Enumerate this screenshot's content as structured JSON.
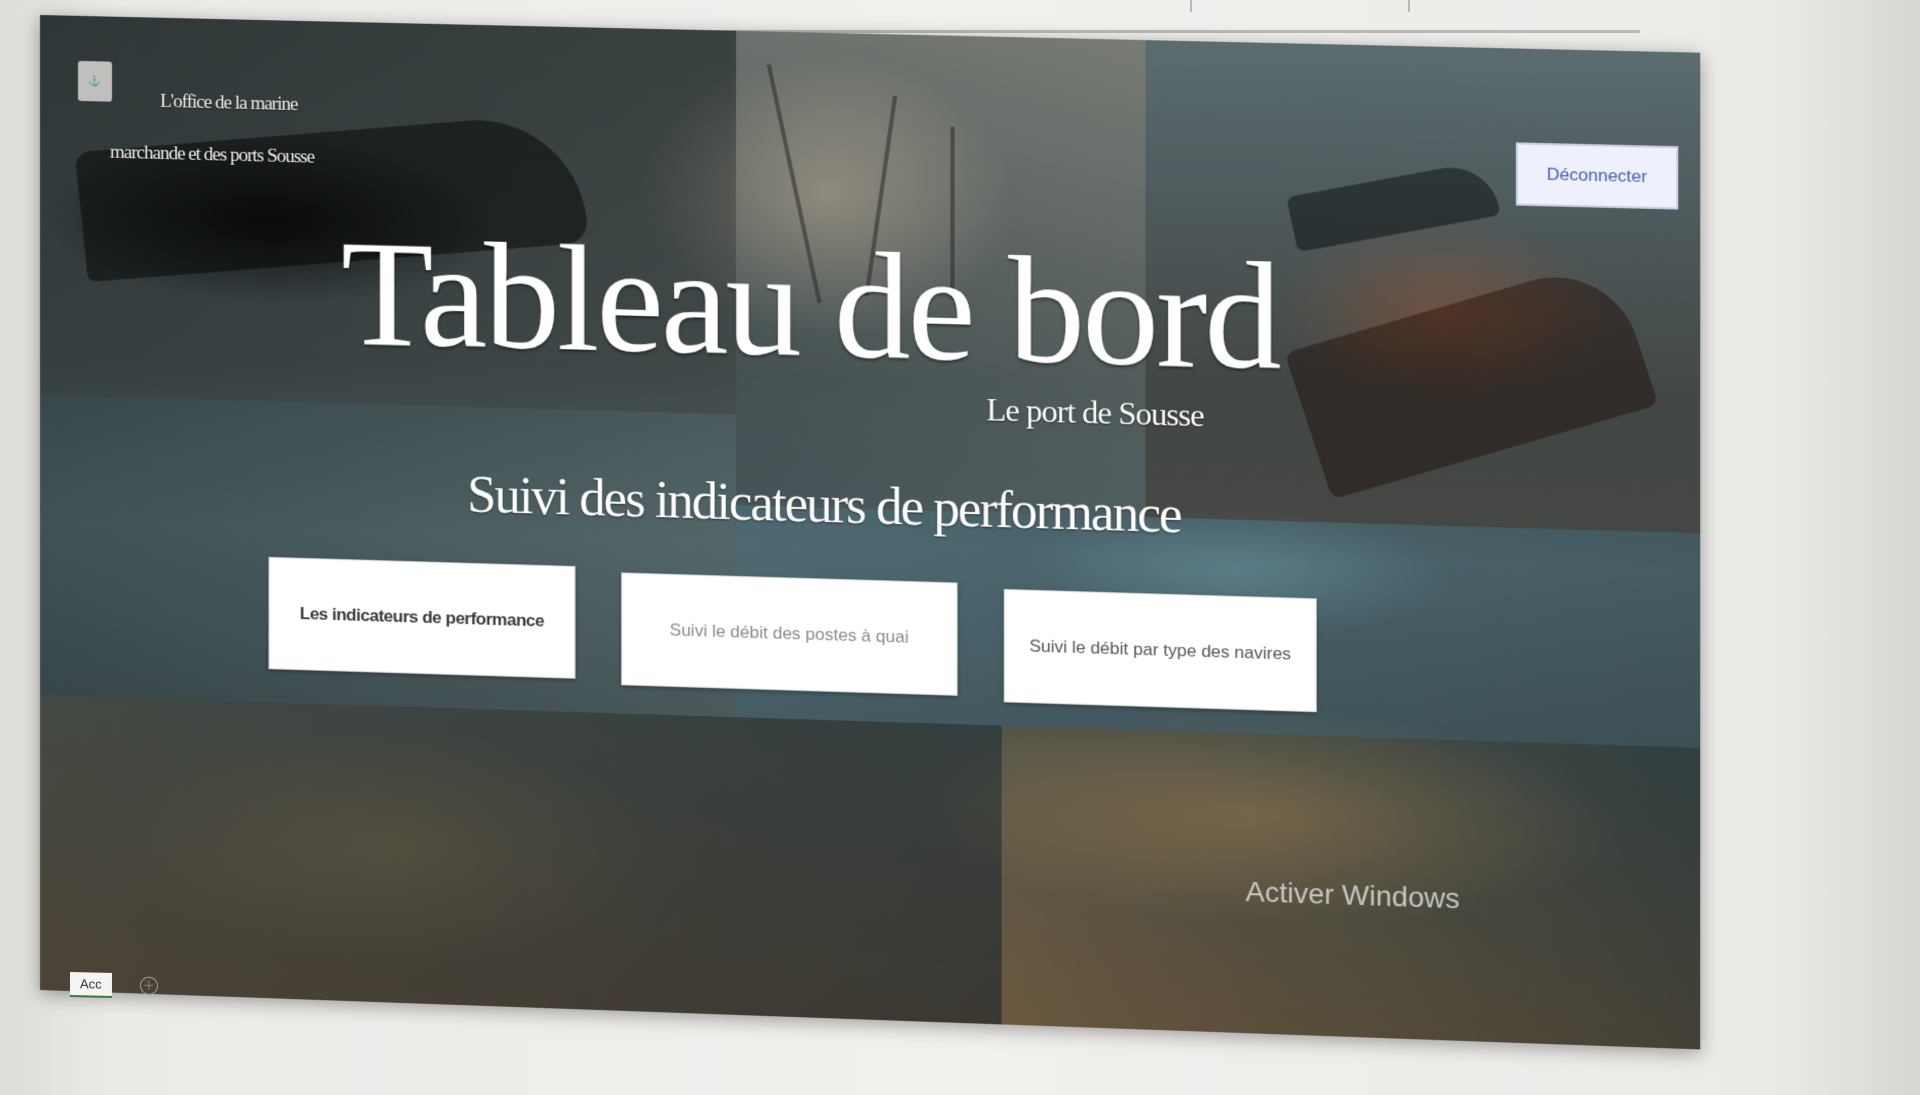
{
  "header": {
    "org_line1": "L'office de la marine",
    "org_line2": "marchande et des ports Sousse",
    "logout_label": "Déconnecter"
  },
  "hero": {
    "title": "Tableau de bord",
    "subtitle": "Le port de Sousse"
  },
  "section": {
    "heading": "Suivi des indicateurs de performance"
  },
  "nav_buttons": [
    {
      "label": "Les indicateurs de performance"
    },
    {
      "label": "Suivi le débit des postes à quai"
    },
    {
      "label": "Suivi le débit par type des navires"
    }
  ],
  "watermark": "Activer Windows",
  "sheet_tabs": [
    {
      "label": "Acc"
    }
  ],
  "icons": {
    "logo": "port-office-logo-icon",
    "add_sheet": "plus-circle-icon"
  }
}
